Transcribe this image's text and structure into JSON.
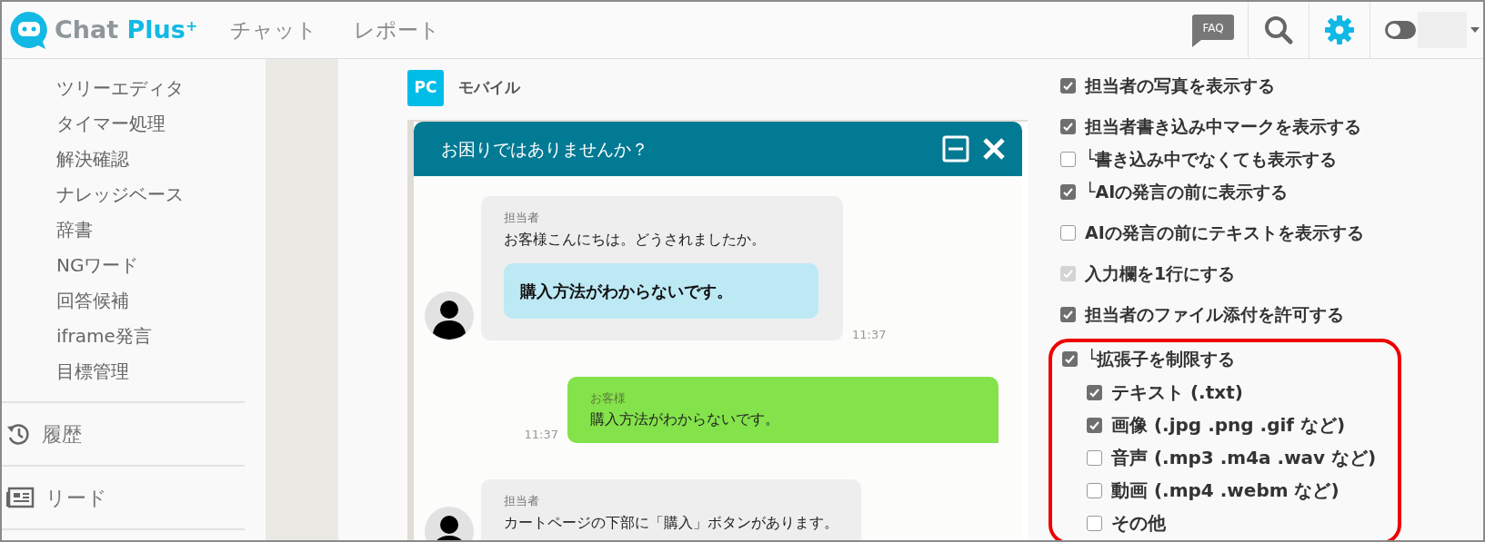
{
  "header": {
    "logo": {
      "word": "Chat",
      "accent": "Plus",
      "mark": "+"
    },
    "nav": [
      {
        "label": "チャット",
        "selected": false
      },
      {
        "label": "レポート",
        "selected": false
      }
    ],
    "faq": "FAQ",
    "tools": [
      {
        "kind": "search",
        "selected": false
      },
      {
        "kind": "settings",
        "selected": true
      }
    ],
    "toggle": {
      "on": false
    }
  },
  "sidebar": {
    "items": [
      "ツリーエディタ",
      "タイマー処理",
      "解決確認",
      "ナレッジベース",
      "辞書",
      "NGワード",
      "回答候補",
      "iframe発言",
      "目標管理"
    ],
    "sections": [
      {
        "kind": "history",
        "label": "履歴"
      },
      {
        "kind": "lead",
        "label": "リード"
      }
    ]
  },
  "preview_tabs": [
    {
      "label": "PC",
      "selected": true
    },
    {
      "label": "モバイル",
      "selected": false
    }
  ],
  "chat": {
    "title": "お困りではありませんか？",
    "messages": [
      {
        "kind": "agent",
        "name": "担当者",
        "text": "お客様こんにちは。どうされましたか。",
        "choice": "購入方法がわからないです。",
        "time": "11:37"
      },
      {
        "kind": "customer",
        "name": "お客様",
        "text": "購入方法がわからないです。",
        "time": "11:37"
      },
      {
        "kind": "agent",
        "name": "担当者",
        "text": "カートページの下部に「購入」ボタンがあります。"
      }
    ]
  },
  "option_groups": [
    [
      {
        "label": "担当者の写真を表示する",
        "checked": true,
        "disabled": false
      }
    ],
    [
      {
        "label": "担当者書き込み中マークを表示する",
        "checked": true,
        "disabled": false
      },
      {
        "label": "└書き込み中でなくても表示する",
        "checked": false,
        "disabled": false
      },
      {
        "label": "└AIの発言の前に表示する",
        "checked": true,
        "disabled": false
      }
    ],
    [
      {
        "label": "AIの発言の前にテキストを表示する",
        "checked": false,
        "disabled": false
      }
    ],
    [
      {
        "label": "入力欄を1行にする",
        "checked": true,
        "disabled": true
      }
    ],
    [
      {
        "label": "担当者のファイル添付を許可する",
        "checked": true,
        "disabled": false
      }
    ],
    [
      {
        "label": "└拡張子を制限する",
        "checked": true,
        "disabled": false,
        "highlighted": true,
        "children": [
          {
            "label": "テキスト (.txt)",
            "checked": true,
            "disabled": false
          },
          {
            "label": "画像 (.jpg .png .gif など)",
            "checked": true,
            "disabled": false
          },
          {
            "label": "音声 (.mp3 .m4a .wav など)",
            "checked": false,
            "disabled": false
          },
          {
            "label": "動画 (.mp4 .webm など)",
            "checked": false,
            "disabled": false
          },
          {
            "label": "その他",
            "checked": false,
            "disabled": false
          }
        ]
      }
    ]
  ]
}
